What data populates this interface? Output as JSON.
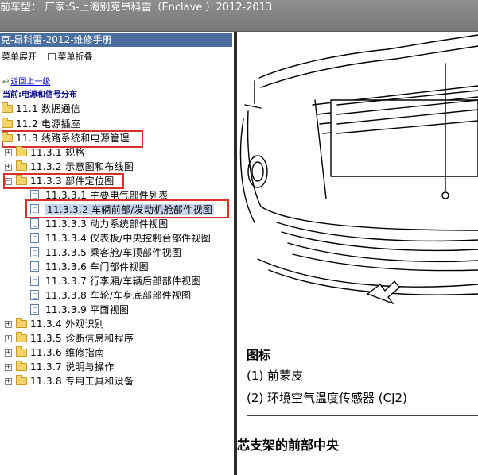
{
  "window": {
    "title": "前车型： 厂家:S-上海别克昂科雷（Enclave ）2012-2013"
  },
  "left_pane": {
    "header": "克-昂科雷-2012-维修手册",
    "toolbar": {
      "expand_label": "菜单展开",
      "collapse_label": "菜单折叠"
    },
    "back_link": "返回上一级",
    "current_path": "当前:电源和信号分布",
    "tree": [
      {
        "label": "11.1 数据通信"
      },
      {
        "label": "11.2 电源插座"
      },
      {
        "label": "11.3 线路系统和电源管理"
      },
      {
        "label": "11.3.1 规格"
      },
      {
        "label": "11.3.2 示意图和布线图"
      },
      {
        "label": "11.3.3 部件定位图"
      },
      {
        "label": "11.3.3.1 主要电气部件列表"
      },
      {
        "label": "11.3.3.2 车辆前部/发动机舱部件视图"
      },
      {
        "label": "11.3.3.3 动力系统部件视图"
      },
      {
        "label": "11.3.3.4 仪表板/中央控制台部件视图"
      },
      {
        "label": "11.3.3.5 乘客舱/车顶部件视图"
      },
      {
        "label": "11.3.3.6 车门部件视图"
      },
      {
        "label": "11.3.3.7 行李厢/车辆后部部件视图"
      },
      {
        "label": "11.3.3.8 车轮/车身底部部件视图"
      },
      {
        "label": "11.3.3.9 平面视图"
      },
      {
        "label": "11.3.4 外观识别"
      },
      {
        "label": "11.3.5 诊断信息和程序"
      },
      {
        "label": "11.3.6 维修指南"
      },
      {
        "label": "11.3.7 说明与操作"
      },
      {
        "label": "11.3.8 专用工具和设备"
      }
    ]
  },
  "right_pane": {
    "legend_title": "图标",
    "legend_items": [
      "(1) 前蒙皮",
      "(2) 环境空气温度传感器 (CJ2)"
    ],
    "section_heading": "芯支架的前部中央"
  },
  "colors": {
    "titlebar_bg": "#808080",
    "header_bg": "#4a6f9e",
    "highlight_border": "#d9302c",
    "selected_bg": "#c7d6ef",
    "link": "#0000cc",
    "folder": "#f4d36a"
  }
}
